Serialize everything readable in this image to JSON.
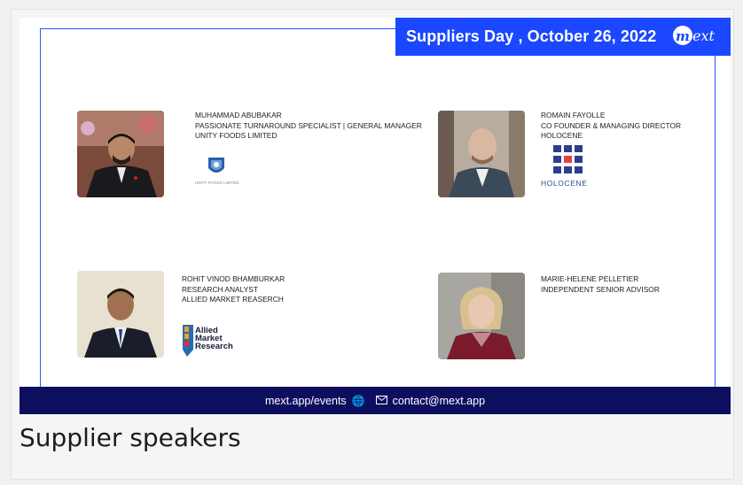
{
  "banner": {
    "title": "Suppliers Day , October 26, 2022",
    "logo_text": "mext"
  },
  "speakers": [
    {
      "name": "MUHAMMAD ABUBAKAR",
      "title": "PASSIONATE TURNAROUND SPECIALIST | GENERAL MANAGER",
      "company": "UNITY FOODS LIMITED",
      "logo_text": "UNITY FOODS LIMITED"
    },
    {
      "name": "ROMAIN FAYOLLE",
      "title": "CO FOUNDER & MANAGING DIRECTOR",
      "company": "HOLOCENE",
      "logo_text": "HOLOCENE"
    },
    {
      "name": "ROHIT VINOD BHAMBURKAR",
      "title": "RESEARCH ANALYST",
      "company": "ALLIED MARKET REASERCH",
      "logo_lines": [
        "Allied",
        "Market",
        "Research"
      ]
    },
    {
      "name": "MARIE-HELENE PELLETIER",
      "title": "INDEPENDENT SENIOR ADVISOR"
    }
  ],
  "footer": {
    "website": "mext.app/events",
    "email": "contact@mext.app",
    "globe_icon": "globe-icon",
    "mail_icon": "mail-icon"
  },
  "caption": "Supplier speakers",
  "colors": {
    "banner": "#1a47ff",
    "footer": "#0d0f5e",
    "frame": "#2b54ff"
  }
}
